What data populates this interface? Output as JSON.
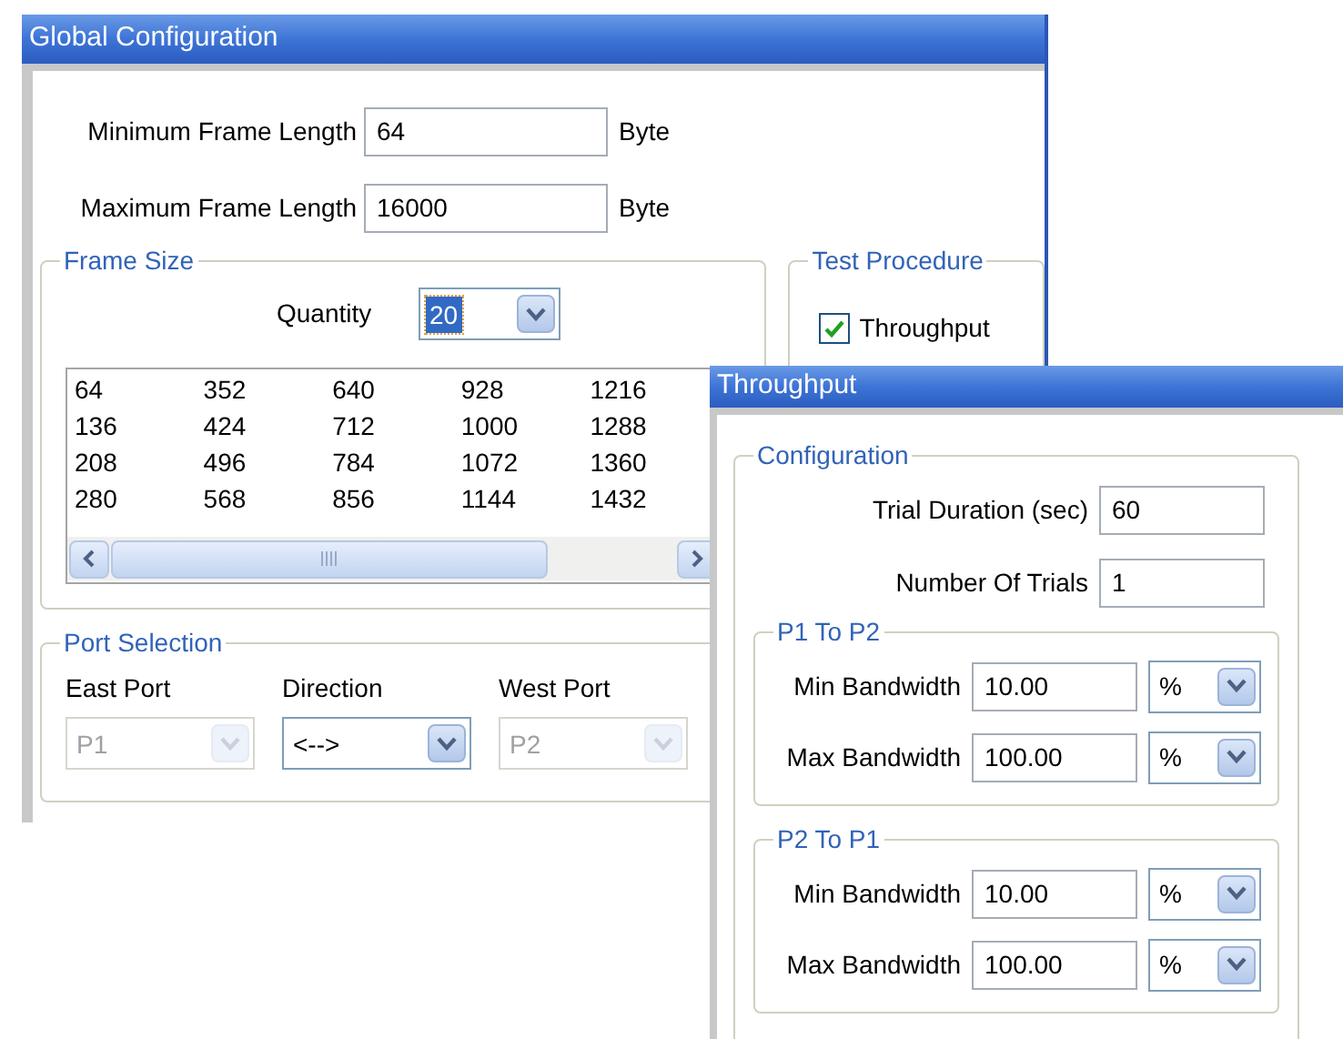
{
  "global_configuration": {
    "title": "Global Configuration",
    "length_fields": [
      {
        "label": "Minimum Frame Length",
        "value": "64",
        "unit": "Byte"
      },
      {
        "label": "Maximum Frame Length",
        "value": "16000",
        "unit": "Byte"
      }
    ],
    "frame_size": {
      "legend": "Frame Size",
      "quantity_label": "Quantity",
      "quantity_value": "20",
      "quantity_highlighted": true,
      "rows": [
        [
          "64",
          "352",
          "640",
          "928",
          "1216"
        ],
        [
          "136",
          "424",
          "712",
          "1000",
          "1288"
        ],
        [
          "208",
          "496",
          "784",
          "1072",
          "1360"
        ],
        [
          "280",
          "568",
          "856",
          "1144",
          "1432"
        ]
      ]
    },
    "test_procedure": {
      "legend": "Test Procedure",
      "options": [
        {
          "label": "Throughput",
          "checked": true
        }
      ]
    },
    "port_selection": {
      "legend": "Port Selection",
      "combos": [
        {
          "label": "East Port",
          "value": "P1",
          "disabled": true
        },
        {
          "label": "Direction",
          "value": "<-->",
          "disabled": false
        },
        {
          "label": "West Port",
          "value": "P2",
          "disabled": true
        }
      ]
    }
  },
  "throughput": {
    "title": "Throughput",
    "legend": "Configuration",
    "fields": [
      {
        "label": "Trial Duration (sec)",
        "value": "60"
      },
      {
        "label": "Number Of Trials",
        "value": "1"
      }
    ],
    "directions": [
      {
        "legend": "P1 To P2",
        "rows": [
          {
            "label": "Min Bandwidth",
            "value": "10.00",
            "unit": "%"
          },
          {
            "label": "Max Bandwidth",
            "value": "100.00",
            "unit": "%"
          }
        ]
      },
      {
        "legend": "P2 To P1",
        "rows": [
          {
            "label": "Min Bandwidth",
            "value": "10.00",
            "unit": "%"
          },
          {
            "label": "Max Bandwidth",
            "value": "100.00",
            "unit": "%"
          }
        ]
      }
    ]
  }
}
